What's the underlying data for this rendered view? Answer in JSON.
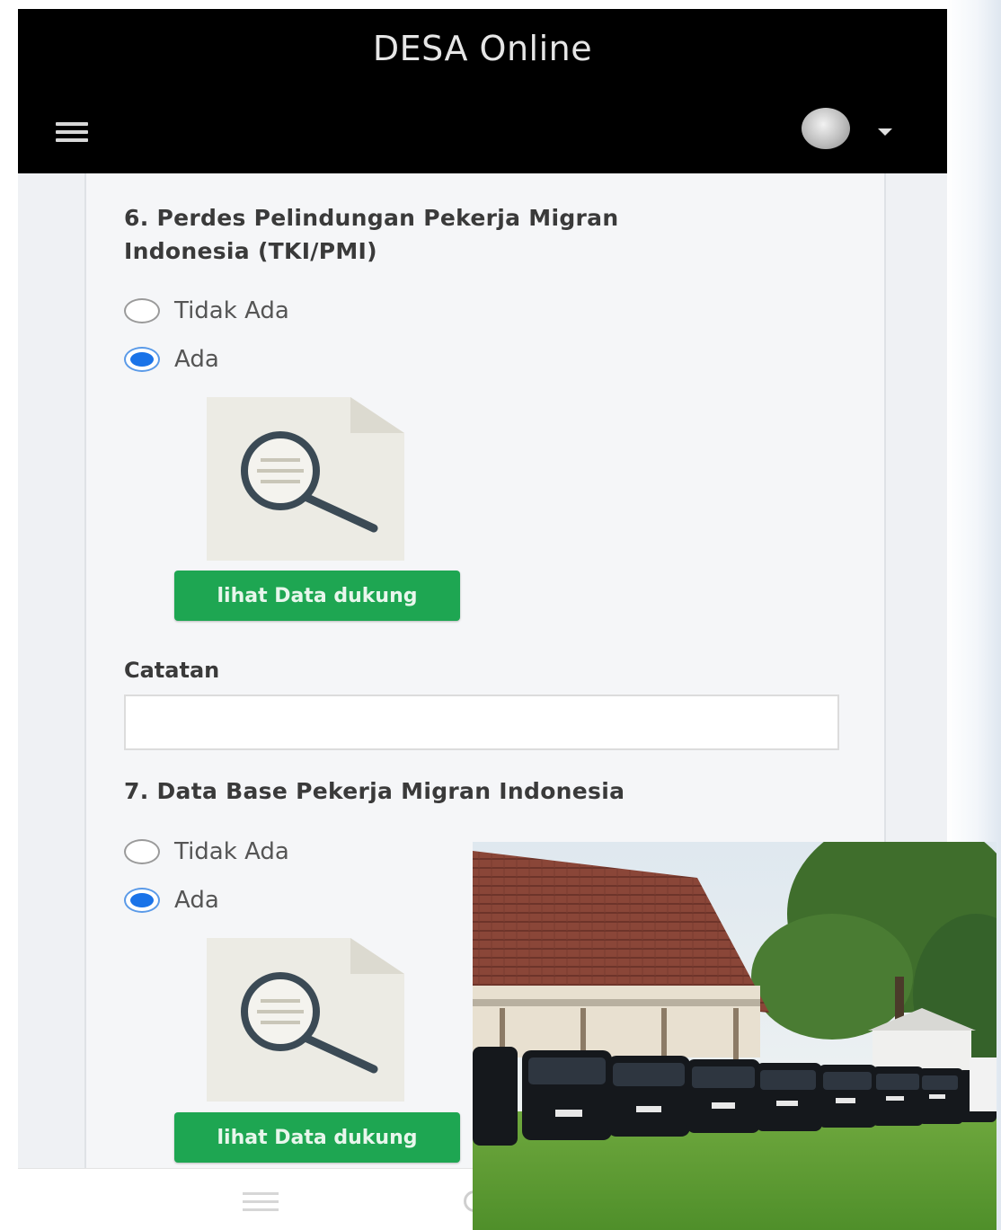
{
  "app": {
    "title": "DESA Online"
  },
  "icons": {
    "menu": "hamburger-menu-icon",
    "avatar": "user-avatar-icon",
    "caret": "chevron-down-icon",
    "document": "document-search-icon"
  },
  "colors": {
    "header_bg": "#000000",
    "button_green": "#1ea652",
    "radio_checked": "#1a73e8",
    "page_bg": "#eff1f4"
  },
  "questions": [
    {
      "title_line1": "6. Perdes Pelindungan Pekerja Migran",
      "title_line2": "Indonesia (TKI/PMI)",
      "options": [
        "Tidak Ada",
        "Ada"
      ],
      "selected": "Ada",
      "button_label": "lihat Data dukung"
    },
    {
      "title_line1": "7. Data Base Pekerja Migran Indonesia",
      "options": [
        "Tidak Ada",
        "Ada"
      ],
      "selected": "Ada",
      "button_label": "lihat Data dukung"
    }
  ],
  "catatan": {
    "label": "Catatan",
    "value": ""
  }
}
